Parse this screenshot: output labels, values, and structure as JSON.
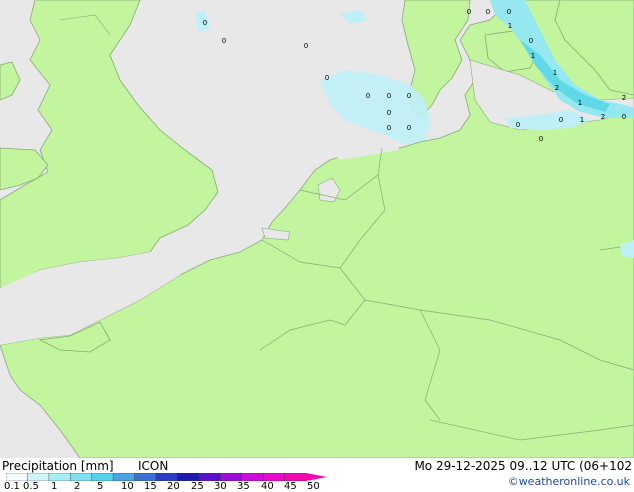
{
  "colors": {
    "sea": "#e8e8e8",
    "land": "#c2f59d",
    "border": "#8aa879",
    "precip_light": "#bff0f8",
    "precip_medium": "#96e8f0",
    "precip_strong": "#5fd9e8"
  },
  "footer": {
    "title": "Precipitation [mm]",
    "model": "ICON",
    "datetime": "Mo 29-12-2025 09..12 UTC (06+102",
    "credit": "©weatheronline.co.uk"
  },
  "legend": {
    "ticks": [
      "0.1",
      "0.5",
      "1",
      "2",
      "5",
      "10",
      "15",
      "20",
      "25",
      "30",
      "35",
      "40",
      "45",
      "50"
    ],
    "colors": [
      "#f5fdfe",
      "#cff4f9",
      "#a8ecf4",
      "#7fe0ef",
      "#56d2ea",
      "#4aa2e0",
      "#3b6fd2",
      "#2a3fc0",
      "#1a1ba8",
      "#5a12c8",
      "#9a10d8",
      "#c80ed8",
      "#e60cc8",
      "#f00ab0"
    ]
  },
  "map_labels": [
    {
      "text": "0"
    },
    {
      "text": "0"
    },
    {
      "text": "0"
    },
    {
      "text": "0"
    },
    {
      "text": "0"
    },
    {
      "text": "0"
    },
    {
      "text": "0"
    },
    {
      "text": "0"
    },
    {
      "text": "0"
    },
    {
      "text": "0"
    },
    {
      "text": "0"
    },
    {
      "text": "1"
    },
    {
      "text": "0"
    },
    {
      "text": "1"
    },
    {
      "text": "1"
    },
    {
      "text": "2"
    },
    {
      "text": "1"
    },
    {
      "text": "2"
    },
    {
      "text": "0"
    },
    {
      "text": "0"
    },
    {
      "text": "0"
    },
    {
      "text": "1"
    },
    {
      "text": "0"
    },
    {
      "text": "0"
    },
    {
      "text": "0"
    },
    {
      "text": "2"
    }
  ]
}
